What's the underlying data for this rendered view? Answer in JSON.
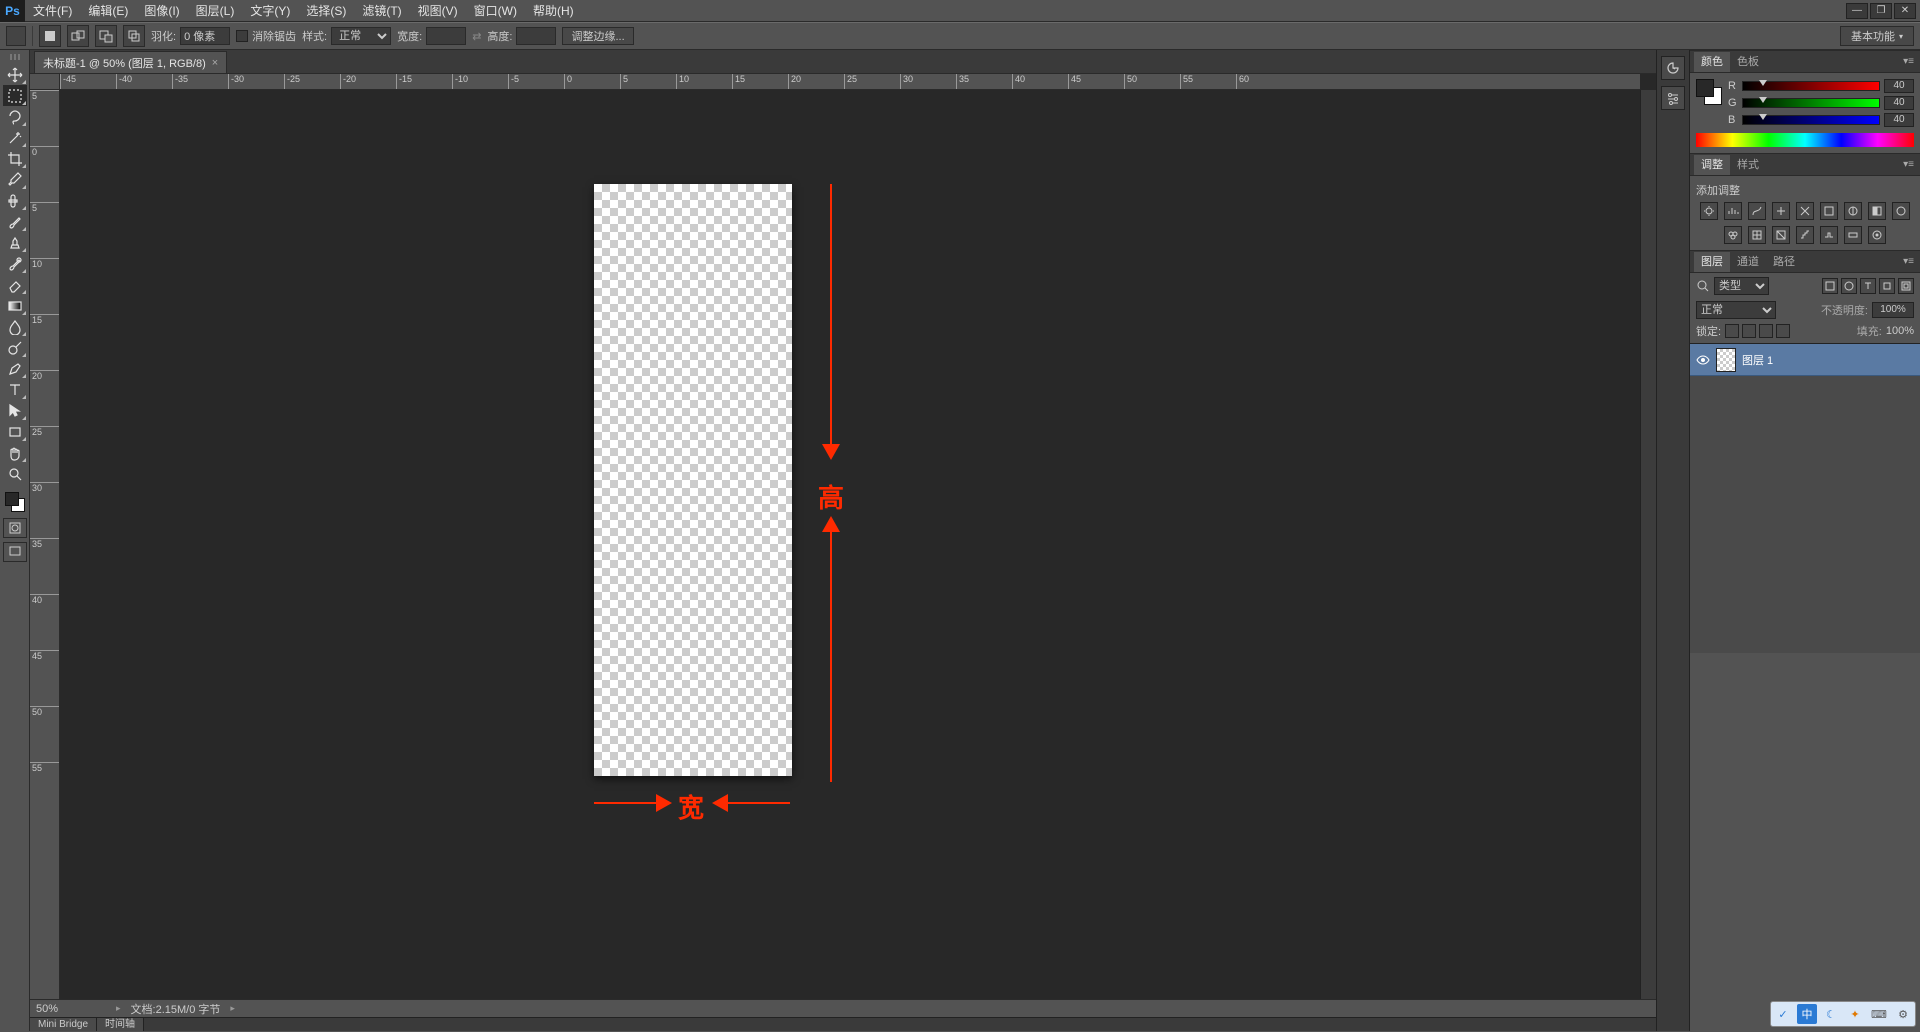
{
  "menu": {
    "items": [
      "文件(F)",
      "编辑(E)",
      "图像(I)",
      "图层(L)",
      "文字(Y)",
      "选择(S)",
      "滤镜(T)",
      "视图(V)",
      "窗口(W)",
      "帮助(H)"
    ],
    "logo": "Ps"
  },
  "window_controls": {
    "minimize": "—",
    "restore": "❐",
    "close": "✕"
  },
  "options_bar": {
    "feather_label": "羽化:",
    "feather_value": "0 像素",
    "antialias_label": "消除锯齿",
    "style_label": "样式:",
    "style_value": "正常",
    "width_label": "宽度:",
    "height_label": "高度:",
    "refine_edge": "调整边缘...",
    "workspace": "基本功能"
  },
  "document": {
    "tab_title": "未标题-1 @ 50% (图层 1, RGB/8)",
    "tab_close": "×",
    "zoom": "50%",
    "doc_info": "文档:2.15M/0 字节",
    "h_ruler_ticks": [
      -45,
      -40,
      -35,
      -30,
      -25,
      -20,
      -15,
      -10,
      -5,
      0,
      5,
      10,
      15,
      20,
      25,
      30,
      35,
      40,
      45,
      50,
      55,
      60
    ],
    "v_ruler_ticks": [
      5,
      0,
      5,
      10,
      15,
      20,
      25,
      30,
      35,
      40,
      45,
      50,
      55
    ],
    "bottom_tabs": [
      "Mini Bridge",
      "时间轴"
    ]
  },
  "annotations": {
    "height_label": "高",
    "width_label": "宽"
  },
  "panels": {
    "color": {
      "tabs": [
        "颜色",
        "色板"
      ],
      "channels": [
        "R",
        "G",
        "B"
      ],
      "values": {
        "R": "40",
        "G": "40",
        "B": "40"
      }
    },
    "adjustments": {
      "tabs": [
        "调整",
        "样式"
      ],
      "add_label": "添加调整"
    },
    "layers": {
      "tabs": [
        "图层",
        "通道",
        "路径"
      ],
      "kind_value": "类型",
      "blend_value": "正常",
      "opacity_label": "不透明度:",
      "opacity_value": "100%",
      "lock_label": "锁定:",
      "fill_label": "填充:",
      "fill_value": "100%",
      "items": [
        {
          "name": "图层 1"
        }
      ]
    }
  },
  "tray": {
    "ime": "中"
  },
  "tool_names": [
    "move",
    "rect-marquee",
    "lasso",
    "magic-wand",
    "crop",
    "eyedropper",
    "spot-heal",
    "brush",
    "clone-stamp",
    "history-brush",
    "eraser",
    "gradient",
    "blur",
    "dodge",
    "pen",
    "type",
    "path-select",
    "rectangle",
    "hand",
    "zoom"
  ],
  "dock_icons": [
    "history",
    "properties"
  ]
}
